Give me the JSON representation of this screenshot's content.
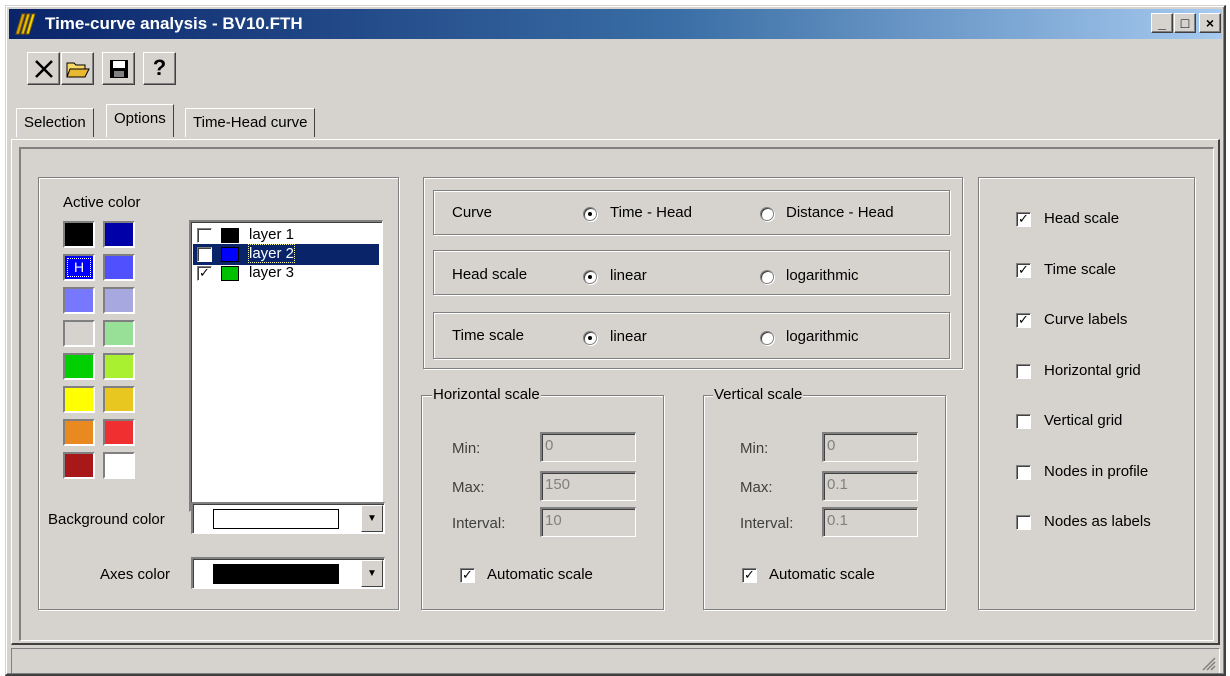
{
  "window": {
    "title": "Time-curve analysis - BV10.FTH",
    "controls": {
      "minimize": "_",
      "maximize": "□",
      "close": "×"
    }
  },
  "toolbar": {
    "buttons": [
      {
        "name": "close-icon",
        "glyph": "✕"
      },
      {
        "name": "open-folder-icon",
        "glyph": "📂"
      },
      {
        "name": "save-icon",
        "glyph": "💾"
      },
      {
        "name": "help-icon",
        "glyph": "?"
      }
    ]
  },
  "tabs": [
    {
      "label": "Selection",
      "active": false
    },
    {
      "label": "Options",
      "active": true
    },
    {
      "label": "Time-Head curve",
      "active": false
    }
  ],
  "colors": {
    "active_color_label": "Active color",
    "palette": [
      [
        "#000000",
        "#0000a8"
      ],
      [
        "#0000ff",
        "#5050ff"
      ],
      [
        "#7878ff",
        "#a8a8e0"
      ],
      [
        "#d6d3ce",
        "#98e098"
      ],
      [
        "#00d000",
        "#a8f030"
      ],
      [
        "#ffff00",
        "#e8c820"
      ],
      [
        "#e88a20",
        "#f03030"
      ],
      [
        "#a81818",
        "#ffffff"
      ]
    ],
    "active_marker": "H",
    "background_color_label": "Background color",
    "background_color_value": "#ffffff",
    "axes_color_label": "Axes color",
    "axes_color_value": "#000000"
  },
  "layers": [
    {
      "label": "layer 1",
      "checked": false,
      "color": "#000000",
      "selected": false
    },
    {
      "label": "layer 2",
      "checked": false,
      "color": "#0000ff",
      "selected": true
    },
    {
      "label": "layer 3",
      "checked": true,
      "color": "#00c000",
      "selected": false
    }
  ],
  "curve_options": {
    "curve": {
      "label": "Curve",
      "opt1": "Time - Head",
      "opt2": "Distance - Head",
      "selected": 1
    },
    "head_scale": {
      "label": "Head scale",
      "opt1": "linear",
      "opt2": "logarithmic",
      "selected": 1
    },
    "time_scale": {
      "label": "Time scale",
      "opt1": "linear",
      "opt2": "logarithmic",
      "selected": 1
    }
  },
  "horizontal_scale": {
    "title": "Horizontal scale",
    "min_label": "Min:",
    "min_value": "0",
    "max_label": "Max:",
    "max_value": "150",
    "interval_label": "Interval:",
    "interval_value": "10",
    "auto_label": "Automatic scale",
    "auto_checked": true
  },
  "vertical_scale": {
    "title": "Vertical scale",
    "min_label": "Min:",
    "min_value": "0",
    "max_label": "Max:",
    "max_value": "0.1",
    "interval_label": "Interval:",
    "interval_value": "0.1",
    "auto_label": "Automatic scale",
    "auto_checked": true
  },
  "display_options": [
    {
      "label": "Head scale",
      "checked": true
    },
    {
      "label": "Time scale",
      "checked": true
    },
    {
      "label": "Curve labels",
      "checked": true
    },
    {
      "label": "Horizontal grid",
      "checked": false
    },
    {
      "label": "Vertical grid",
      "checked": false
    },
    {
      "label": "Nodes in profile",
      "checked": false
    },
    {
      "label": "Nodes as labels",
      "checked": false
    }
  ]
}
